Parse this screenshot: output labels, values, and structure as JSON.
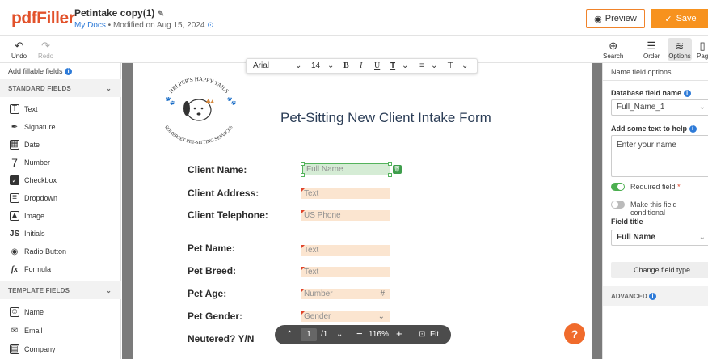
{
  "header": {
    "logo": "pdfFiller",
    "doc_title": "Petintake copy(1)",
    "breadcrumb_link": "My Docs",
    "modified": "Modified on Aug 15, 2024",
    "preview_label": "Preview",
    "save_label": "Save"
  },
  "toolbar": {
    "undo": "Undo",
    "redo": "Redo",
    "search": "Search",
    "order": "Order",
    "options": "Options",
    "pages": "Pag"
  },
  "left_panel": {
    "add_title": "Add fillable fields",
    "standard_header": "STANDARD FIELDS",
    "standard_items": [
      {
        "label": "Text",
        "icon": "text-box-icon"
      },
      {
        "label": "Signature",
        "icon": "signature-pen-icon"
      },
      {
        "label": "Date",
        "icon": "calendar-icon"
      },
      {
        "label": "Number",
        "icon": "number-seven-icon"
      },
      {
        "label": "Checkbox",
        "icon": "checkbox-icon"
      },
      {
        "label": "Dropdown",
        "icon": "dropdown-list-icon"
      },
      {
        "label": "Image",
        "icon": "image-icon"
      },
      {
        "label": "Initials",
        "icon": "initials-icon"
      },
      {
        "label": "Radio Button",
        "icon": "radio-button-icon"
      },
      {
        "label": "Formula",
        "icon": "formula-fx-icon"
      }
    ],
    "template_header": "TEMPLATE FIELDS",
    "template_items": [
      {
        "label": "Name",
        "icon": "person-card-icon"
      },
      {
        "label": "Email",
        "icon": "envelope-icon"
      },
      {
        "label": "Company",
        "icon": "building-icon"
      }
    ]
  },
  "format_bar": {
    "font": "Arial",
    "size": "14",
    "bold": "B",
    "italic": "I",
    "underline": "U"
  },
  "document": {
    "logo_top": "HELPER'S HAPPY TAILS",
    "logo_bottom": "SOMERSET PET-SITTING SERVICES",
    "title": "Pet-Sitting New Client Intake Form",
    "rows": [
      {
        "label": "Client Name:",
        "placeholder": "Full Name"
      },
      {
        "label": "Client Address:",
        "placeholder": "Text"
      },
      {
        "label": "Client Telephone:",
        "placeholder": "US Phone"
      },
      {
        "label": "Pet Name:",
        "placeholder": "Text"
      },
      {
        "label": "Pet Breed:",
        "placeholder": "Text"
      },
      {
        "label": "Pet Age:",
        "placeholder": "Number"
      },
      {
        "label": "Pet Gender:",
        "placeholder": "Gender"
      },
      {
        "label": "Neutered? Y/N",
        "placeholder": ""
      }
    ]
  },
  "zoom_bar": {
    "page": "1",
    "total": "/1",
    "zoom": "116%",
    "fit": "Fit"
  },
  "help": "?",
  "right_panel": {
    "title": "Name field options",
    "db_label": "Database field name",
    "db_value": "Full_Name_1",
    "help_label": "Add some text to help",
    "help_value": "Enter your name",
    "required_label": "Required field",
    "required_on": true,
    "conditional_label": "Make this field conditional",
    "conditional_on": false,
    "field_title_label": "Field title",
    "field_title_value": "Full Name",
    "change_type": "Change field type",
    "advanced": "ADVANCED"
  },
  "colors": {
    "brand": "#e2522b",
    "save": "#f7921e",
    "field_fill": "#fbe5d0",
    "selected_fill": "#d5ecd5",
    "selected_border": "#54b35c"
  }
}
